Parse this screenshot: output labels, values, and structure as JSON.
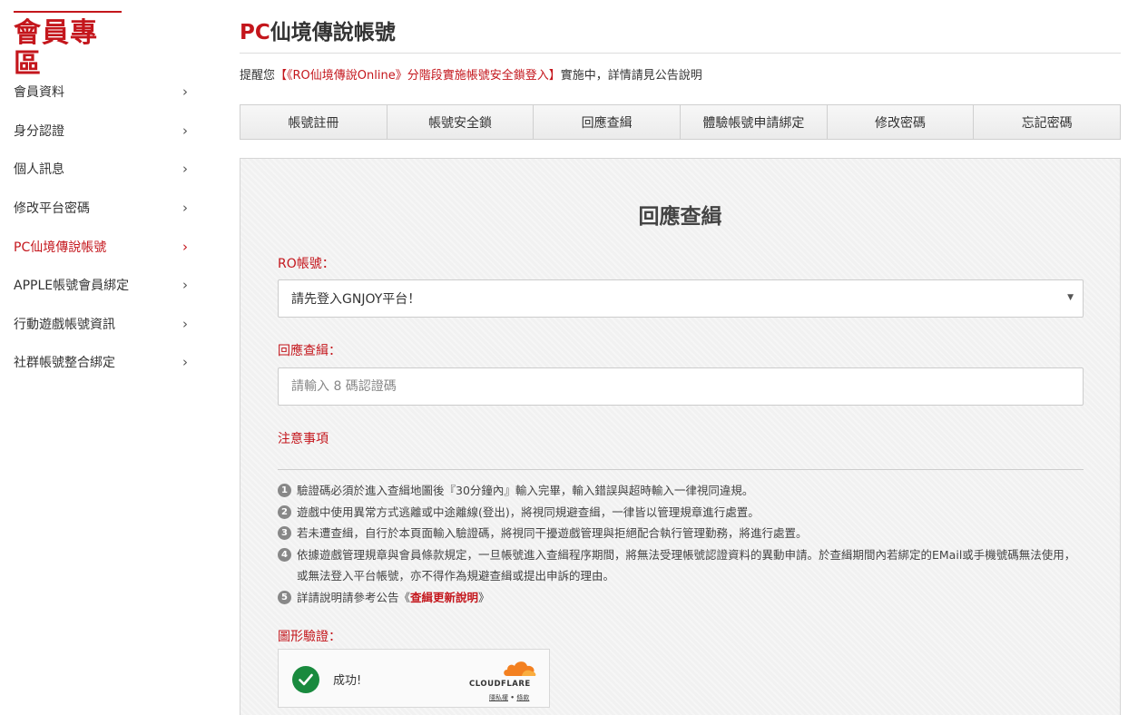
{
  "sidebar": {
    "brand": "會員專區",
    "items": [
      {
        "label": "會員資料"
      },
      {
        "label": "身分認證"
      },
      {
        "label": "個人訊息"
      },
      {
        "label": "修改平台密碼"
      },
      {
        "label": "PC仙境傳說帳號"
      },
      {
        "label": "APPLE帳號會員綁定"
      },
      {
        "label": "行動遊戲帳號資訊"
      },
      {
        "label": "社群帳號整合綁定"
      }
    ],
    "active_index": 4,
    "chevron": "›"
  },
  "header": {
    "title_prefix": "PC",
    "title_rest": "仙境傳說帳號"
  },
  "notice": {
    "prefix": "提醒您",
    "highlight": "【《RO仙境傳說Online》分階段實施帳號安全鎖登入】",
    "suffix": "實施中，詳情請見公告說明"
  },
  "tabs": [
    {
      "label": "帳號註冊"
    },
    {
      "label": "帳號安全鎖"
    },
    {
      "label": "回應查緝"
    },
    {
      "label": "體驗帳號申請綁定"
    },
    {
      "label": "修改密碼"
    },
    {
      "label": "忘記密碼"
    }
  ],
  "panel": {
    "title": "回應查緝",
    "account_label": "RO帳號：",
    "account_value": "請先登入GNJOY平台！",
    "code_label": "回應查緝：",
    "code_placeholder": "請輸入 8 碼認證碼",
    "notes_label": "注意事項",
    "notes": [
      {
        "n": "1",
        "text": "驗證碼必須於進入查緝地圖後『30分鐘內』輸入完畢，輸入錯誤與超時輸入一律視同違規。"
      },
      {
        "n": "2",
        "text": "遊戲中使用異常方式逃離或中途離線(登出)，將視同規避查緝，一律皆以管理規章進行處置。"
      },
      {
        "n": "3",
        "text": "若未遭查緝，自行於本頁面輸入驗證碼，將視同干擾遊戲管理與拒絕配合執行管理勤務，將進行處置。"
      },
      {
        "n": "4",
        "text": "依據遊戲管理規章與會員條款規定，一旦帳號進入查緝程序期間，將無法受理帳號認證資料的異動申請。於查緝期間內若綁定的EMail或手機號碼無法使用，或無法登入平台帳號，亦不得作為規避查緝或提出申訴的理由。"
      }
    ],
    "note5_n": "5",
    "note5_prefix": "詳請說明請參考公告《",
    "note5_link": "查緝更新說明",
    "note5_suffix": "》",
    "captcha_label": "圖形驗證：",
    "captcha_status": "成功!",
    "captcha_brand": "CLOUDFLARE",
    "captcha_privacy": "隱私權",
    "captcha_sep": " • ",
    "captcha_terms": "條款"
  },
  "colors": {
    "accent": "#c4161c",
    "success": "#198a3e",
    "cloudflare": "#f38020"
  },
  "icons": {
    "chevron": "chevron-right-icon",
    "caret": "caret-down-icon",
    "check": "check-circle-icon",
    "cloud": "cloudflare-cloud-icon"
  }
}
